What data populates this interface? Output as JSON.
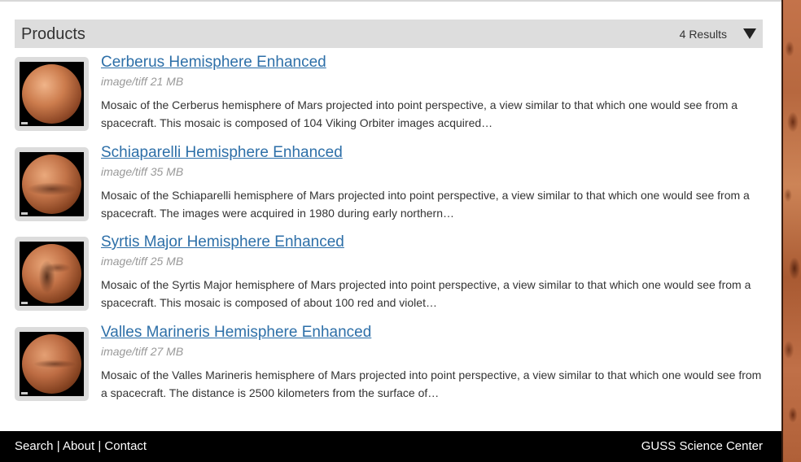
{
  "header": {
    "title": "Products",
    "results_count": "4 Results"
  },
  "products": [
    {
      "title": "Cerberus Hemisphere Enhanced",
      "meta": "image/tiff 21 MB",
      "description": "Mosaic of the Cerberus hemisphere of Mars projected into point perspective, a view similar to that which one would see from a spacecraft. This mosaic is composed of 104 Viking Orbiter images acquired…"
    },
    {
      "title": "Schiaparelli Hemisphere Enhanced",
      "meta": "image/tiff 35 MB",
      "description": "Mosaic of the Schiaparelli hemisphere of Mars projected into point perspective, a view similar to that which one would see from a spacecraft. The images were acquired in 1980 during early northern…"
    },
    {
      "title": "Syrtis Major Hemisphere Enhanced",
      "meta": "image/tiff 25 MB",
      "description": "Mosaic of the Syrtis Major hemisphere of Mars projected into point perspective, a view similar to that which one would see from a spacecraft. This mosaic is composed of about 100 red and violet…"
    },
    {
      "title": "Valles Marineris Hemisphere Enhanced",
      "meta": "image/tiff 27 MB",
      "description": "Mosaic of the Valles Marineris hemisphere of Mars projected into point perspective, a view similar to that which one would see from a spacecraft. The distance is 2500 kilometers from the surface of…"
    }
  ],
  "footer": {
    "links": [
      "Search",
      "About",
      "Contact"
    ],
    "separator": "|",
    "right_text": "GUSS Science Center"
  },
  "icons": {
    "sort_toggle": "triangle-down-icon"
  }
}
